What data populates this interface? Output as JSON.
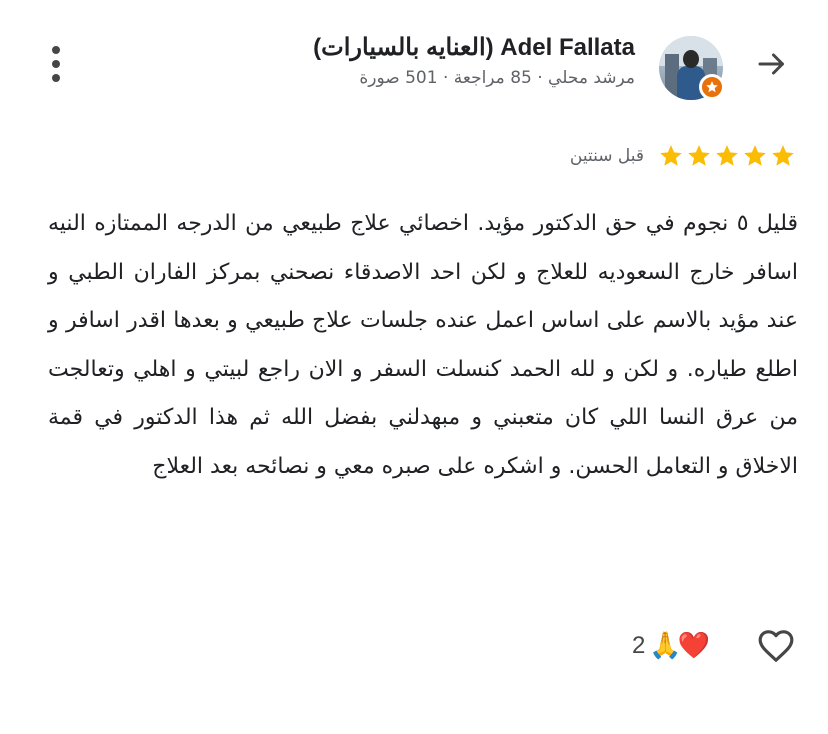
{
  "header": {
    "back_icon": "arrow-icon",
    "name": "Adel Fallata (العنايه بالسيارات)",
    "meta": "مرشد محلي · 85 مراجعة · 501 صورة",
    "more_icon": "more-vert-icon",
    "badge_icon": "local-guide-star-icon",
    "badge_color": "#e8710a"
  },
  "rating": {
    "stars": 5,
    "max_stars": 5,
    "star_color": "#fbbc04",
    "date": "قبل سنتين"
  },
  "review": {
    "text": "قليل ٥ نجوم في حق الدكتور مؤيد. اخصائي علاج طبيعي من الدرجه الممتازه النيه اسافر خارج السعوديه للعلاج و لكن احد الاصدقاء نصحني بمركز الفاران الطبي و عند مؤيد بالاسم على اساس اعمل عنده جلسات علاج طبيعي و بعدها اقدر اسافر و اطلع طياره. و لكن و لله الحمد كنسلت السفر و الان راجع لبيتي و اهلي وتعالجت من عرق النسا اللي كان متعبني و مبهدلني بفضل الله ثم هذا الدكتور في قمة الاخلاق و التعامل الحسن. و اشكره على صبره معي و نصائحه بعد العلاج"
  },
  "reactions": {
    "count": "2",
    "emojis": [
      "❤️",
      "🙏"
    ],
    "like_icon": "heart-outline-icon"
  }
}
